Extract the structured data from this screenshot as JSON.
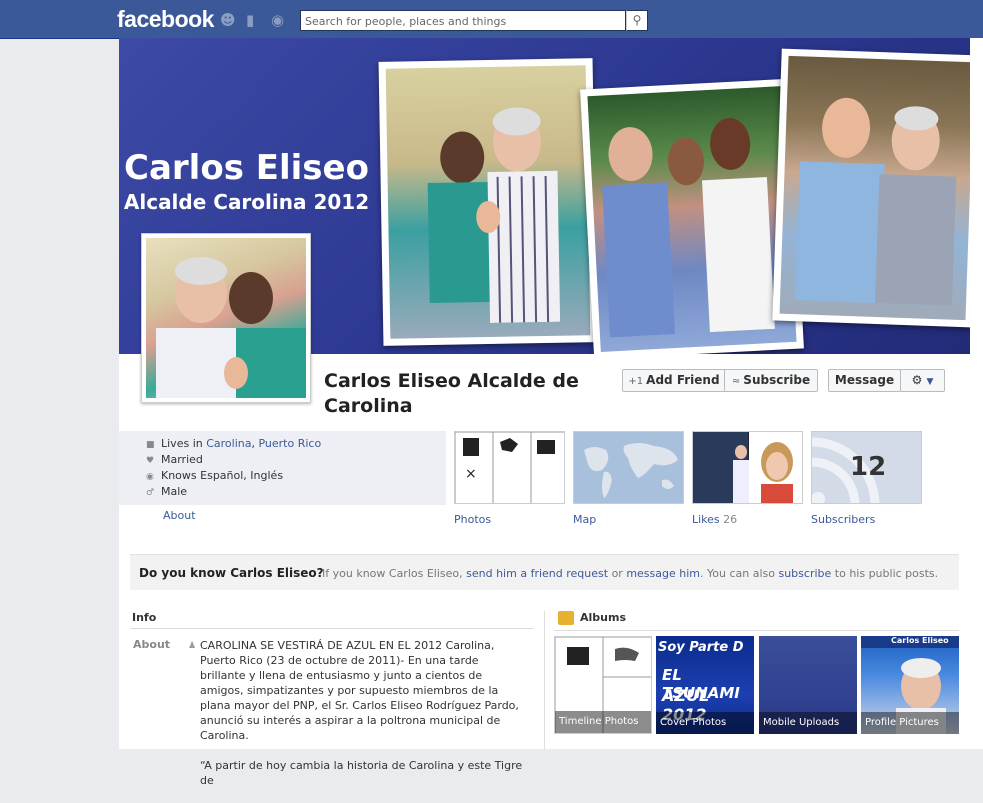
{
  "header": {
    "logo": "facebook",
    "search_placeholder": "Search for people, places and things",
    "colors": {
      "bar": "#3b5998",
      "link": "#3b5998"
    }
  },
  "cover": {
    "title_line1": "Carlos Eliseo",
    "title_line2": "Alcalde Carolina 2012"
  },
  "profile": {
    "name": "Carlos Eliseo Alcalde de Carolina",
    "buttons": {
      "add_friend": "Add Friend",
      "subscribe": "Subscribe",
      "message": "Message"
    }
  },
  "about": {
    "lives_in_prefix": "Lives in",
    "city": "Carolina",
    "region": "Puerto Rico",
    "relationship": "Married",
    "languages": "Knows Español, Inglés",
    "gender": "Male",
    "about_link": "About"
  },
  "tiles": {
    "photos_label": "Photos",
    "map_label": "Map",
    "likes_label": "Likes",
    "likes_count": "26",
    "subscribers_label": "Subscribers",
    "subscribers_count": "12"
  },
  "do_you_know": {
    "title": "Do you know Carlos Eliseo?",
    "text_a": "If you know Carlos Eliseo,",
    "link_request": "send him a friend request",
    "text_or": "or",
    "link_message": "message him",
    "text_b": ". You can also",
    "link_subscribe": "subscribe",
    "text_c": "to his public posts."
  },
  "info": {
    "heading": "Info",
    "about_label": "About",
    "paragraph1": "CAROLINA SE VESTIRÁ DE AZUL EN EL 2012 Carolina, Puerto Rico (23 de octubre de 2011)- En una tarde brillante y llena de entusiasmo y junto a cientos de amigos, simpatizantes y por supuesto miembros de la plana mayor del PNP, el Sr. Carlos Eliseo Rodríguez Pardo, anunció su interés a aspirar a la poltrona municipal de Carolina.",
    "paragraph2": "“A partir de hoy cambia la historia de Carolina y este Tigre de"
  },
  "albums": {
    "heading": "Albums",
    "items": [
      {
        "label": "Timeline Photos"
      },
      {
        "label": "Cover Photos",
        "overlay_line1": "Soy Parte D",
        "overlay_line2": "EL TSUNAMI",
        "overlay_line3": "AZUL 2012"
      },
      {
        "label": "Mobile Uploads"
      },
      {
        "label": "Profile Pictures",
        "overlay_line1": "Carlos Eliseo"
      }
    ]
  }
}
